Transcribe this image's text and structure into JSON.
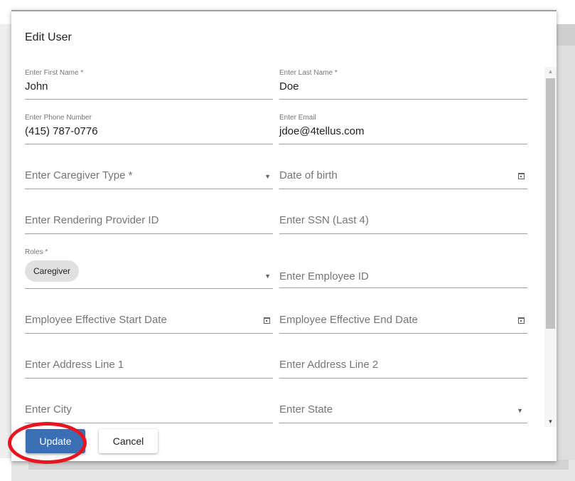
{
  "dialog": {
    "title": "Edit User",
    "update_label": "Update",
    "cancel_label": "Cancel"
  },
  "fields": {
    "first_name": {
      "label": "Enter First Name *",
      "value": "John"
    },
    "last_name": {
      "label": "Enter Last Name *",
      "value": "Doe"
    },
    "phone": {
      "label": "Enter Phone Number",
      "value": "(415) 787-0776"
    },
    "email": {
      "label": "Enter Email",
      "value": "jdoe@4tellus.com"
    },
    "caregiver_type": {
      "placeholder": "Enter Caregiver Type *"
    },
    "dob": {
      "placeholder": "Date of birth"
    },
    "rendering_provider": {
      "placeholder": "Enter Rendering Provider ID"
    },
    "ssn": {
      "placeholder": "Enter SSN (Last 4)"
    },
    "roles": {
      "label": "Roles *",
      "chips": [
        "Caregiver"
      ]
    },
    "employee_id": {
      "placeholder": "Enter Employee ID"
    },
    "start_date": {
      "placeholder": "Employee Effective Start Date"
    },
    "end_date": {
      "placeholder": "Employee Effective End Date"
    },
    "address1": {
      "placeholder": "Enter Address Line 1"
    },
    "address2": {
      "placeholder": "Enter Address Line 2"
    },
    "city": {
      "placeholder": "Enter City"
    },
    "state": {
      "placeholder": "Enter State"
    }
  },
  "icons": {
    "dropdown": "caret-down-icon",
    "calendar": "calendar-icon",
    "scroll_up": "scroll-up-arrow",
    "scroll_down": "scroll-down-arrow"
  },
  "colors": {
    "primary_button": "#3a6fb5",
    "highlight": "#e8141f"
  }
}
